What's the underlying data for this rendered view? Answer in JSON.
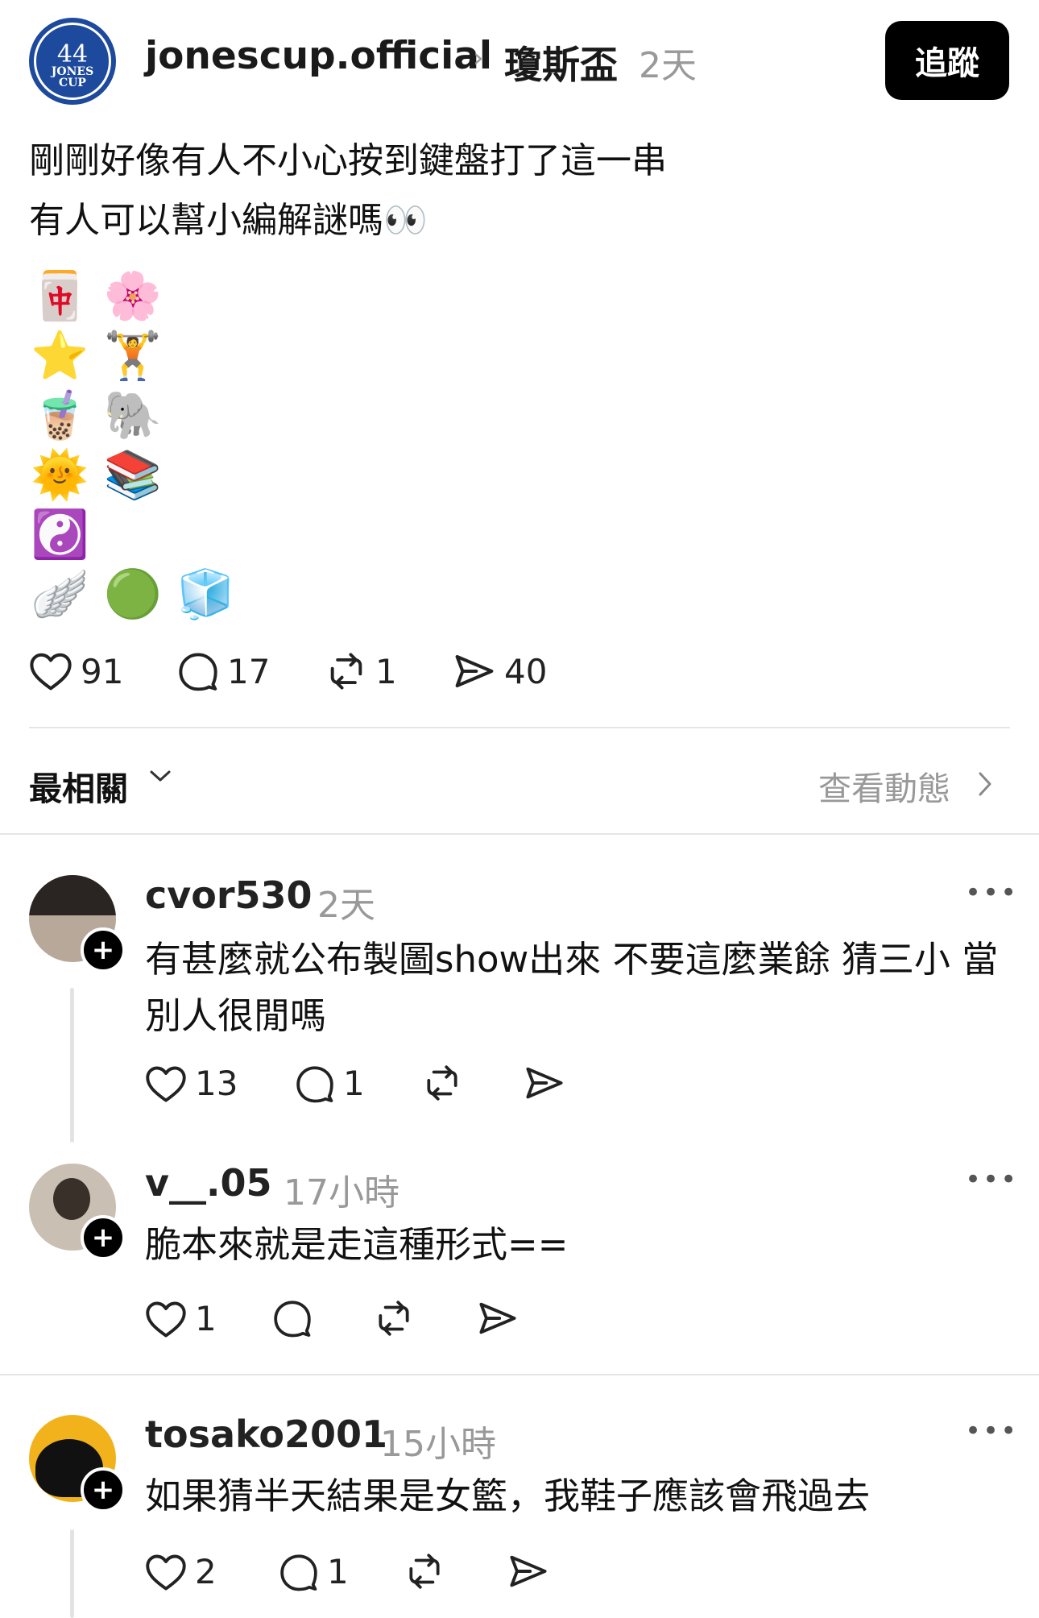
{
  "post": {
    "username": "jonescup.official",
    "community": "瓊斯盃",
    "time": "2天",
    "follow_label": "追蹤",
    "text_lines": [
      "剛剛好像有人不小心按到鍵盤打了這一串",
      "有人可以幫小編解謎嗎👀"
    ],
    "emoji_lines": [
      "🀄 🌸",
      "⭐ 🏋️",
      "🧋 🐘",
      "🌞 📚",
      "☯️",
      "🪽 🟢 🧊"
    ],
    "likes": "91",
    "comments": "17",
    "reposts": "1",
    "shares": "40"
  },
  "sort": {
    "label": "最相關",
    "activity_link": "查看動態"
  },
  "comments": [
    {
      "username": "cvor530",
      "time": "2天",
      "text": "有甚麼就公布製圖show出來 不要這麼業餘 猜三小 當別人很閒嗎",
      "likes": "13",
      "replies": "1"
    },
    {
      "username": "v__.05",
      "time": "17小時",
      "text": "脆本來就是走這種形式==",
      "likes": "1"
    },
    {
      "username": "tosako2001",
      "time": "15小時",
      "text": "如果猜半天結果是女籃，我鞋子應該會飛過去",
      "likes": "2",
      "replies": "1"
    }
  ]
}
